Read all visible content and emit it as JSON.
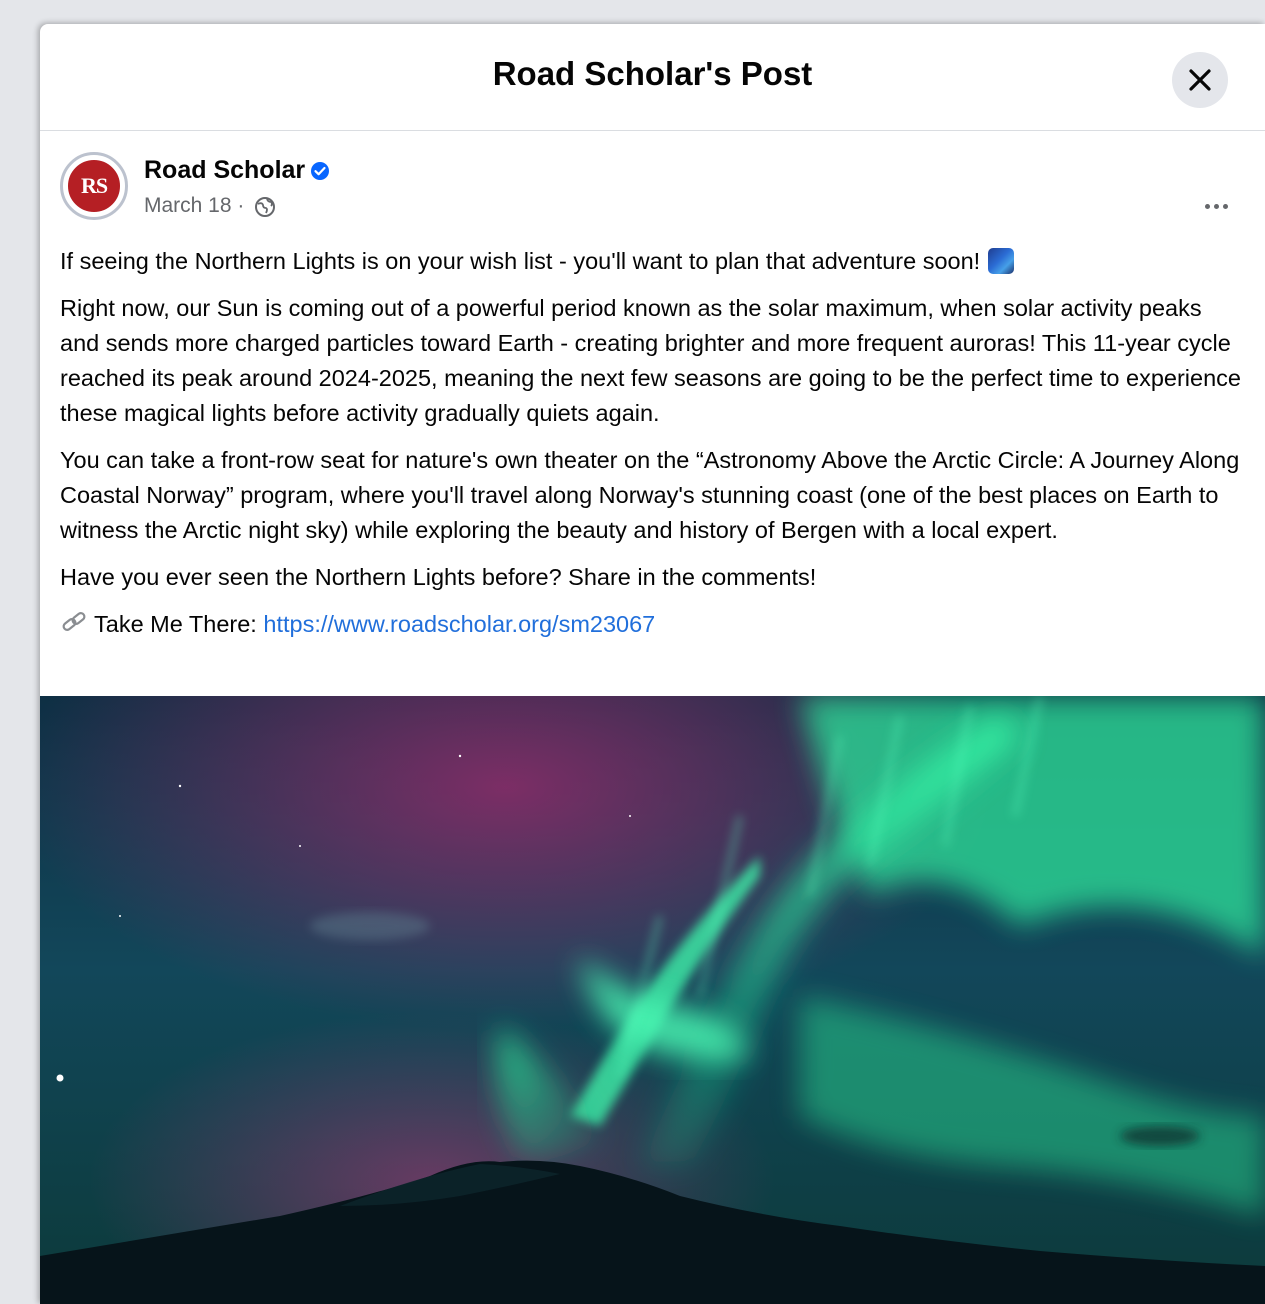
{
  "modal": {
    "title": "Road Scholar's Post",
    "close_icon": "close-icon"
  },
  "post": {
    "avatar_text": "RS",
    "author": "Road Scholar",
    "verified_icon": "verified-badge-icon",
    "date": "March 18 ·",
    "audience_icon": "globe-icon",
    "more_icon": "more-options-icon",
    "paragraphs": [
      "If seeing the Northern Lights is on your wish list - you'll want to plan that adventure soon!",
      "Right now, our Sun is coming out of a powerful period known as the solar maximum, when solar activity peaks and sends more charged particles toward Earth - creating brighter and more frequent auroras! This 11-year cycle reached its peak around 2024-2025, meaning the next few seasons are going to be the perfect time to experience these magical lights before activity gradually quiets again.",
      "You can take a front-row seat for nature's own theater on the “Astronomy Above the Arctic Circle: A Journey Along Coastal Norway” program, where you'll travel along Norway's stunning coast (one of the best places on Earth to witness the Arctic night sky) while exploring the beauty and history of Bergen with a local expert.",
      "Have you ever seen the Northern Lights before? Share in the comments!"
    ],
    "aurora_emoji_icon": "aurora-emoji-icon",
    "link_icon": "link-icon",
    "link_prefix": "Take Me There: ",
    "link_text": "https://www.roadscholar.org/sm23067",
    "image_subject": "aurora-over-mountain-photo"
  },
  "colors": {
    "link": "#216fdb",
    "brand_red": "#b51f24",
    "aurora_green": "#2fe59a",
    "aurora_magenta": "#a02a6e"
  }
}
